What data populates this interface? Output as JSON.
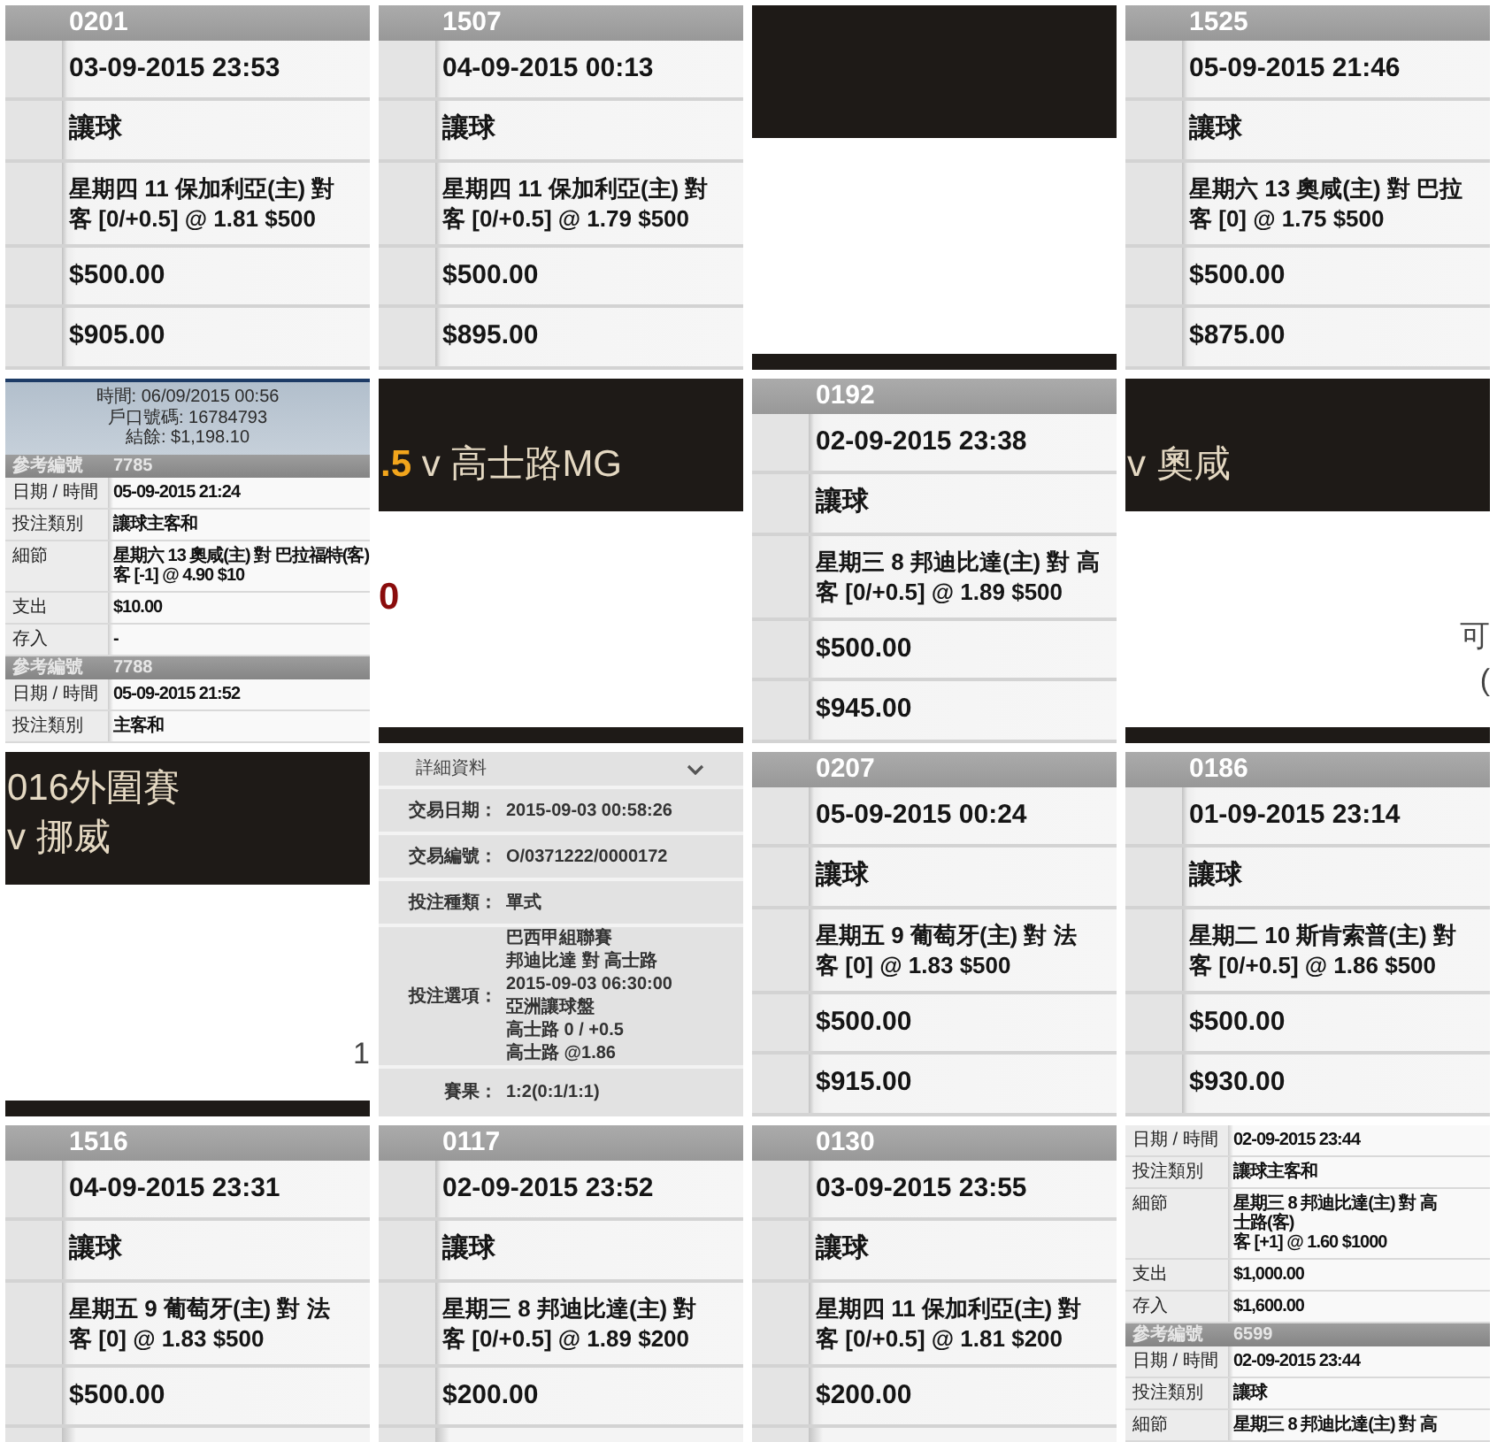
{
  "tiles": [
    {
      "kind": "bet_slip",
      "ref": "0201",
      "date": "03-09-2015 23:53",
      "bet_type": "讓球",
      "detail": [
        "星期四 11 保加利亞(主) 對",
        "客 [0/+0.5] @ 1.81 $500"
      ],
      "stake": "$500.00",
      "return": "$905.00"
    },
    {
      "kind": "bet_slip",
      "ref": "1507",
      "date": "04-09-2015 00:13",
      "bet_type": "讓球",
      "detail": [
        "星期四 11 保加利亞(主) 對",
        "客 [0/+0.5] @ 1.79 $500"
      ],
      "stake": "$500.00",
      "return": "$895.00"
    },
    {
      "kind": "video"
    },
    {
      "kind": "bet_slip",
      "ref": "1525",
      "date": "05-09-2015 21:46",
      "bet_type": "讓球",
      "detail": [
        "星期六 13 奧咸(主) 對 巴拉",
        "客 [0] @ 1.75 $500"
      ],
      "stake": "$500.00",
      "return": "$875.00"
    },
    {
      "kind": "statement",
      "summary": [
        "時間: 06/09/2015 00:56",
        "戶口號碼: 16784793",
        "結餘: $1,198.10"
      ],
      "rows": [
        {
          "kind": "ref",
          "label": "參考編號",
          "value": [
            "7785"
          ]
        },
        {
          "kind": "field",
          "label": "日期 / 時間",
          "value": [
            "05-09-2015 21:24"
          ]
        },
        {
          "kind": "field",
          "label": "投注類別",
          "value": [
            "讓球主客和"
          ]
        },
        {
          "kind": "field",
          "label": "細節",
          "value": [
            "星期六 13 奧咸(主) 對 巴拉福特(客)",
            "客 [-1] @ 4.90 $10"
          ]
        },
        {
          "kind": "field",
          "label": "支出",
          "value": [
            "$10.00"
          ]
        },
        {
          "kind": "field",
          "label": "存入",
          "value": [
            "-"
          ]
        },
        {
          "kind": "ref",
          "label": "參考編號",
          "value": [
            "7788"
          ]
        },
        {
          "kind": "field",
          "label": "日期 / 時間",
          "value": [
            "05-09-2015 21:52"
          ]
        },
        {
          "kind": "field",
          "label": "投注類別",
          "value": [
            "主客和"
          ]
        }
      ]
    },
    {
      "kind": "video",
      "handicap": ".5",
      "title": [
        "v 高士路MG"
      ],
      "score": "0"
    },
    {
      "kind": "bet_slip",
      "ref": "0192",
      "date": "02-09-2015 23:38",
      "bet_type": "讓球",
      "detail": [
        "星期三 8 邦迪比達(主) 對 高",
        "客 [0/+0.5] @ 1.89 $500"
      ],
      "stake": "$500.00",
      "return": "$945.00"
    },
    {
      "kind": "video",
      "title": [
        "v 奧咸"
      ],
      "edge_text": [
        "可",
        "("
      ]
    },
    {
      "kind": "video",
      "title": [
        "016外圍賽",
        "v 挪威"
      ],
      "edge_text": [
        "1"
      ]
    },
    {
      "kind": "details",
      "title": "詳細資料",
      "rows": [
        {
          "label": "交易日期：",
          "value": [
            "2015-09-03 00:58:26"
          ]
        },
        {
          "label": "交易編號：",
          "value": [
            "O/0371222/0000172"
          ]
        },
        {
          "label": "投注種類：",
          "value": [
            "單式"
          ]
        },
        {
          "label": "投注選項：",
          "value": [
            "巴西甲組聯賽",
            "邦迪比達 對 高士路",
            "2015-09-03 06:30:00",
            "亞洲讓球盤",
            "高士路 0 / +0.5",
            "高士路 @1.86"
          ]
        },
        {
          "label": "賽果：",
          "value": [
            "1:2(0:1/1:1)"
          ]
        }
      ]
    },
    {
      "kind": "bet_slip",
      "ref": "0207",
      "date": "05-09-2015 00:24",
      "bet_type": "讓球",
      "detail": [
        "星期五 9 葡萄牙(主) 對 法",
        "客 [0] @ 1.83 $500"
      ],
      "stake": "$500.00",
      "return": "$915.00"
    },
    {
      "kind": "bet_slip",
      "ref": "0186",
      "date": "01-09-2015 23:14",
      "bet_type": "讓球",
      "detail": [
        "星期二 10 斯肯索普(主) 對",
        "客 [0/+0.5] @ 1.86 $500"
      ],
      "stake": "$500.00",
      "return": "$930.00"
    },
    {
      "kind": "bet_slip",
      "ref": "1516",
      "date": "04-09-2015 23:31",
      "bet_type": "讓球",
      "detail": [
        "星期五 9 葡萄牙(主) 對 法",
        "客 [0] @ 1.83 $500"
      ],
      "stake": "$500.00"
    },
    {
      "kind": "bet_slip",
      "ref": "0117",
      "date": "02-09-2015 23:52",
      "bet_type": "讓球",
      "detail": [
        "星期三 8 邦迪比達(主) 對",
        "客 [0/+0.5] @ 1.89 $200"
      ],
      "stake": "$200.00"
    },
    {
      "kind": "bet_slip",
      "ref": "0130",
      "date": "03-09-2015 23:55",
      "bet_type": "讓球",
      "detail": [
        "星期四 11 保加利亞(主) 對",
        "客 [0/+0.5] @ 1.81 $200"
      ],
      "stake": "$200.00"
    },
    {
      "kind": "statement",
      "rows": [
        {
          "kind": "field",
          "label": "日期 / 時間",
          "value": [
            "02-09-2015 23:44"
          ]
        },
        {
          "kind": "field",
          "label": "投注類別",
          "value": [
            "讓球主客和"
          ]
        },
        {
          "kind": "field",
          "label": "細節",
          "value": [
            "星期三 8 邦迪比達(主) 對 高",
            "士路(客)",
            "客 [+1] @ 1.60 $1000"
          ]
        },
        {
          "kind": "field",
          "label": "支出",
          "value": [
            "$1,000.00"
          ]
        },
        {
          "kind": "field",
          "label": "存入",
          "value": [
            "$1,600.00"
          ]
        },
        {
          "kind": "ref",
          "label": "參考編號",
          "value": [
            "6599"
          ]
        },
        {
          "kind": "field",
          "label": "日期 / 時間",
          "value": [
            "02-09-2015 23:44"
          ]
        },
        {
          "kind": "field",
          "label": "投注類別",
          "value": [
            "讓球"
          ]
        },
        {
          "kind": "field",
          "label": "細節",
          "value": [
            "星期三 8 邦迪比達(主) 對 高"
          ]
        }
      ]
    }
  ]
}
